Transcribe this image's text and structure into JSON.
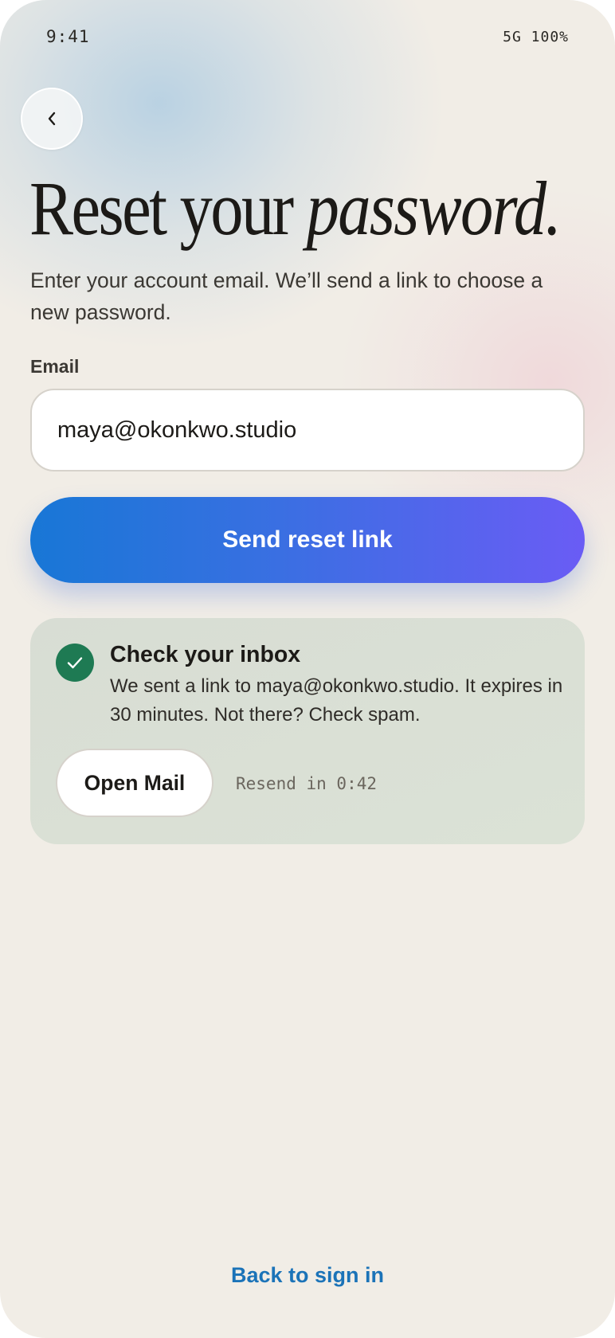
{
  "status_bar": {
    "time": "9:41",
    "network_battery": "5G 100%"
  },
  "back_button": {
    "icon": "chevron-left-icon",
    "glyph": "‹"
  },
  "header": {
    "title_plain": "Reset your",
    "title_emphasis": "password."
  },
  "description": "Enter your account email. We’ll send a link to choose a new password.",
  "email": {
    "label": "Email",
    "value": "maya@okonkwo.studio"
  },
  "primary_action": {
    "label": "Send reset link"
  },
  "confirmation": {
    "icon": "check-icon",
    "title": "Check your inbox",
    "body": "We sent a link to maya@okonkwo.studio. It expires in 30 minutes. Not there? Check spam.",
    "open_mail_label": "Open Mail",
    "resend_text": "Resend in 0:42"
  },
  "footer": {
    "back_to_sign_in": "Back to sign in"
  },
  "colors": {
    "background": "#f1ede6",
    "button_gradient_start": "#1877d6",
    "button_gradient_end": "#6a5cf5",
    "success": "#1e7a53",
    "notice_background": "#dbe2d6",
    "link": "#1b73b8"
  }
}
